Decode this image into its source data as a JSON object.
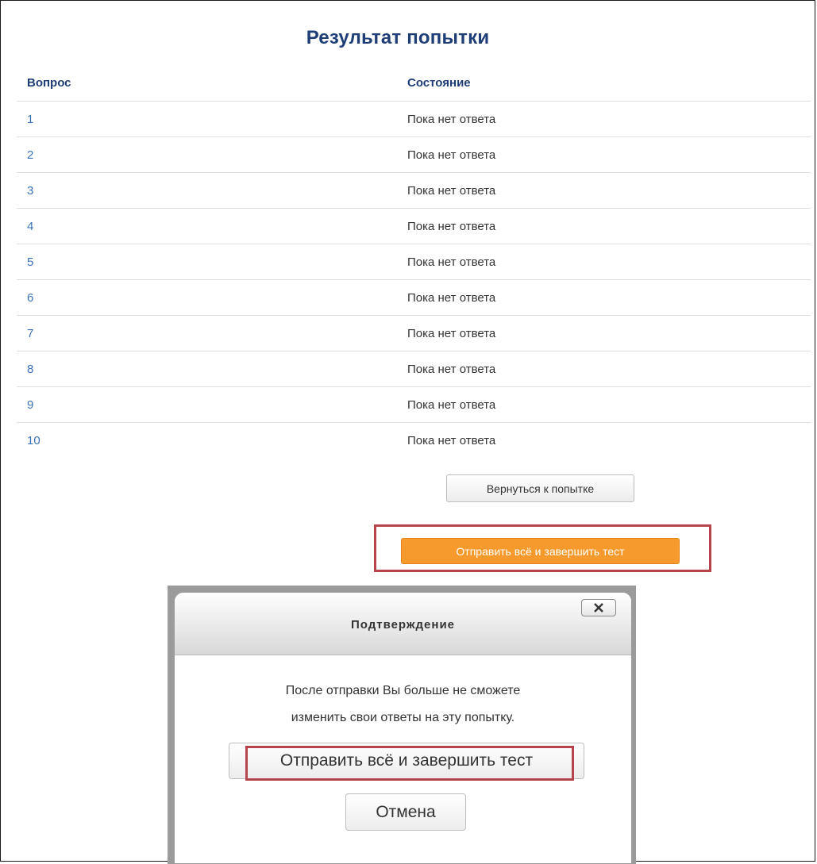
{
  "summary": {
    "title": "Результат попытки",
    "columns": {
      "question": "Вопрос",
      "status": "Состояние"
    },
    "rows": [
      {
        "number": "1",
        "status": "Пока нет ответа"
      },
      {
        "number": "2",
        "status": "Пока нет ответа"
      },
      {
        "number": "3",
        "status": "Пока нет ответа"
      },
      {
        "number": "4",
        "status": "Пока нет ответа"
      },
      {
        "number": "5",
        "status": "Пока нет ответа"
      },
      {
        "number": "6",
        "status": "Пока нет ответа"
      },
      {
        "number": "7",
        "status": "Пока нет ответа"
      },
      {
        "number": "8",
        "status": "Пока нет ответа"
      },
      {
        "number": "9",
        "status": "Пока нет ответа"
      },
      {
        "number": "10",
        "status": "Пока нет ответа"
      }
    ],
    "return_button": "Вернуться к попытке",
    "submit_button": "Отправить всё и завершить тест"
  },
  "dialog": {
    "title": "Подтверждение",
    "message_line1": "После отправки Вы больше не сможете",
    "message_line2": "изменить свои ответы на эту попытку.",
    "confirm_button": "Отправить всё и завершить тест",
    "cancel_button": "Отмена",
    "close_icon": "close-icon"
  },
  "colors": {
    "heading": "#1f3e78",
    "link": "#3a71b5",
    "submit": "#f79a2e",
    "highlight": "#b6444a"
  }
}
